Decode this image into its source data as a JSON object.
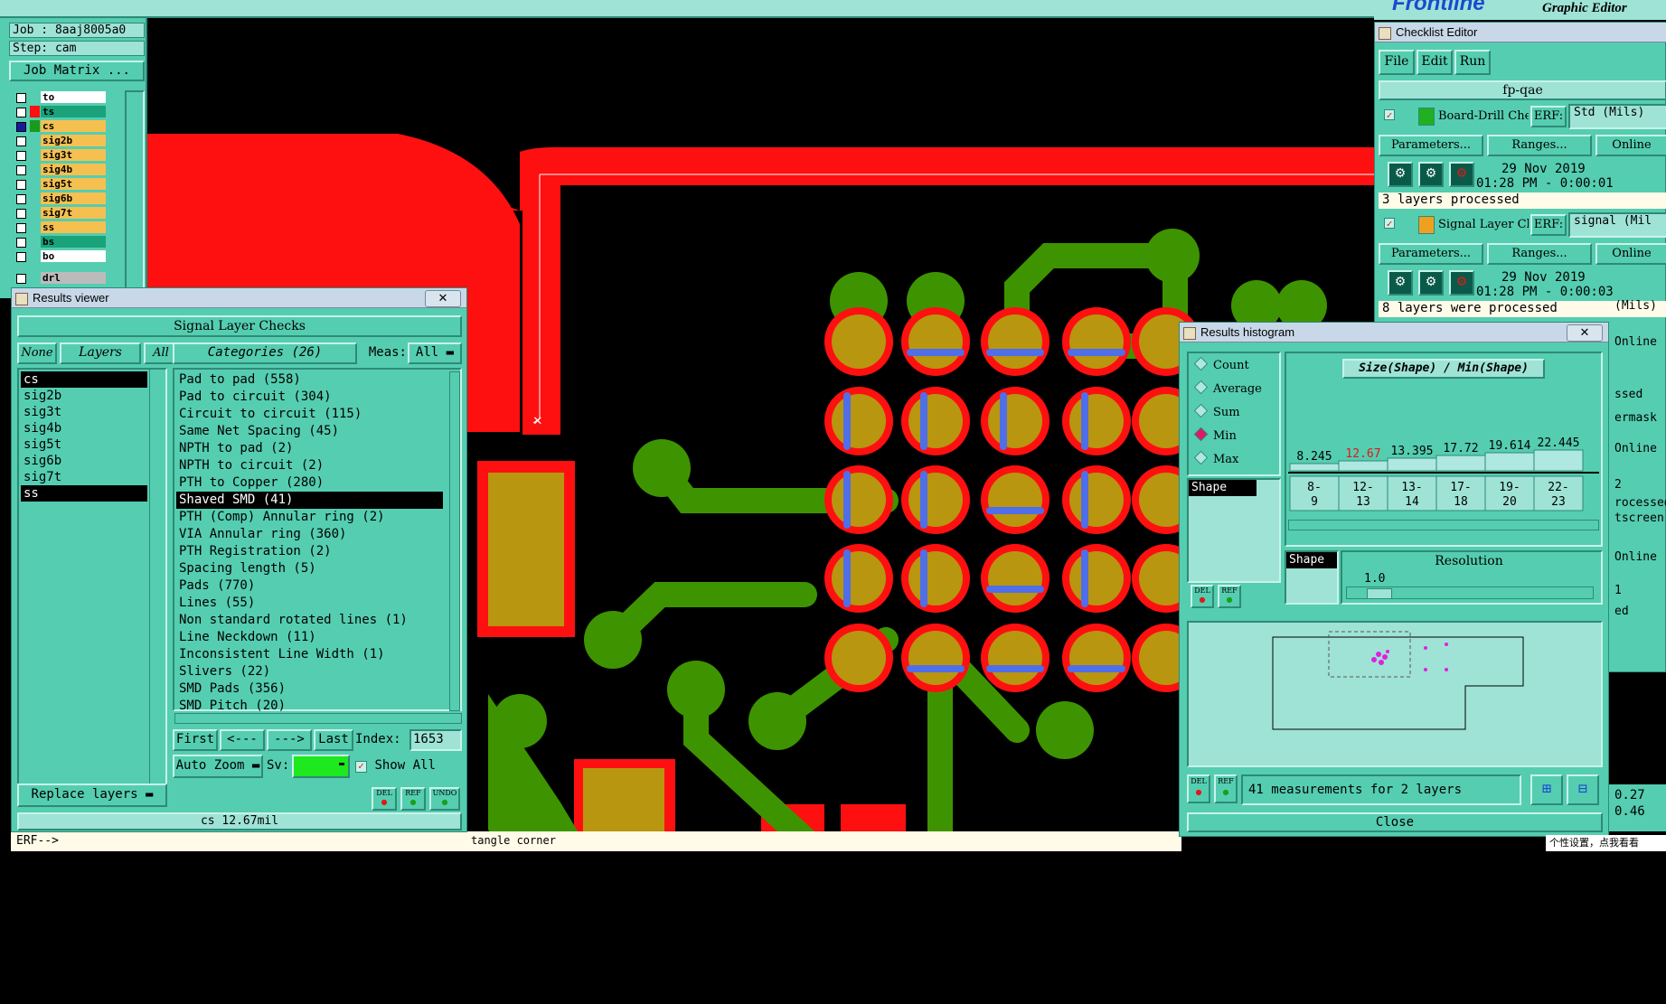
{
  "app": {
    "brand": "Frontline",
    "subtitle": "Graphic Editor"
  },
  "job_panel": {
    "job": "Job : 8aaj8005a0",
    "step": "Step: cam",
    "job_matrix_label": "Job Matrix ...",
    "layers": [
      {
        "name": "to",
        "color": "#ffffff"
      },
      {
        "name": "ts",
        "color": "#1aa37a"
      },
      {
        "name": "cs",
        "color": "#f5c050"
      },
      {
        "name": "sig2b",
        "color": "#f5c050"
      },
      {
        "name": "sig3t",
        "color": "#f5c050"
      },
      {
        "name": "sig4b",
        "color": "#f5c050"
      },
      {
        "name": "sig5t",
        "color": "#f5c050"
      },
      {
        "name": "sig6b",
        "color": "#f5c050"
      },
      {
        "name": "sig7t",
        "color": "#f5c050"
      },
      {
        "name": "ss",
        "color": "#f5c050"
      },
      {
        "name": "bs",
        "color": "#1aa37a"
      },
      {
        "name": "bo",
        "color": "#ffffff"
      },
      {
        "name": "drl",
        "color": "#bbbbbb"
      }
    ]
  },
  "results_viewer": {
    "title": "Results viewer",
    "heading": "Signal Layer Checks",
    "none_label": "None",
    "layers_label": "Layers",
    "all_label": "All",
    "categories_label": "Categories (26)",
    "meas_label": "Meas:",
    "meas_value": "All",
    "layers": [
      "cs",
      "sig2b",
      "sig3t",
      "sig4b",
      "sig5t",
      "sig6b",
      "sig7t",
      "ss"
    ],
    "categories": [
      "Pad to pad (558)",
      "Pad to circuit (304)",
      "Circuit to circuit (115)",
      "Same Net Spacing (45)",
      "NPTH to pad (2)",
      "NPTH to circuit (2)",
      "PTH to Copper (280)",
      "Shaved SMD (41)",
      "PTH (Comp) Annular ring (2)",
      "VIA Annular ring (360)",
      "PTH Registration (2)",
      "Spacing length (5)",
      "Pads (770)",
      "Lines (55)",
      "Non standard rotated lines (1)",
      "Line Neckdown (11)",
      "Inconsistent Line Width (1)",
      "Slivers (22)",
      "SMD Pads (356)",
      "SMD Pitch (20)"
    ],
    "first": "First",
    "prev": "<---",
    "next": "--->",
    "last": "Last",
    "index_label": "Index:",
    "index_value": "1653",
    "auto_zoom": "Auto Zoom",
    "sv_label": "Sv:",
    "show_all": "Show All",
    "replace_layers": "Replace layers",
    "del": "DEL",
    "ref": "REF",
    "undo": "UNDO",
    "status": "cs 12.67mil"
  },
  "command_line": {
    "prompt": "ERF-->",
    "hint": "tangle corner"
  },
  "checklist_editor": {
    "title": "Checklist Editor",
    "menu": [
      "File",
      "Edit",
      "Run"
    ],
    "checklist_name": "fp-qae",
    "items": [
      {
        "name": "Board-Drill Che",
        "erf_label": "ERF:",
        "erf_value": "Std (Mils)",
        "params": "Parameters...",
        "ranges": "Ranges...",
        "online": "Online",
        "date": "29 Nov 2019",
        "time": "01:28 PM - 0:00:01",
        "status": "3 layers processed"
      },
      {
        "name": "Signal Layer Ch",
        "erf_label": "ERF:",
        "erf_value": "signal (Mil",
        "params": "Parameters...",
        "ranges": "Ranges...",
        "online": "Online",
        "date": "29 Nov 2019",
        "time": "01:28 PM - 0:00:03",
        "status": "8 layers were processed"
      }
    ],
    "partial_right": [
      "(Mils)",
      "Online",
      "ssed",
      "ermask",
      "Online",
      "2",
      "rocessed",
      "tscreen",
      "Online",
      "1",
      "ed"
    ]
  },
  "histogram": {
    "title": "Results histogram",
    "modes": [
      "Count",
      "Average",
      "Sum",
      "Min",
      "Max"
    ],
    "selected_mode": "Min",
    "chart_title": "Size(Shape) / Min(Shape)",
    "list_item": "Shape",
    "bins": [
      {
        "range": "8-9",
        "lo": "8-",
        "hi": "9",
        "value": "8.245",
        "color": "#000000"
      },
      {
        "range": "12-13",
        "lo": "12-",
        "hi": "13",
        "value": "12.67",
        "color": "#e01818"
      },
      {
        "range": "13-14",
        "lo": "13-",
        "hi": "14",
        "value": "13.395",
        "color": "#000000"
      },
      {
        "range": "17-18",
        "lo": "17-",
        "hi": "18",
        "value": "17.72",
        "color": "#000000"
      },
      {
        "range": "19-20",
        "lo": "19-",
        "hi": "20",
        "value": "19.614",
        "color": "#000000"
      },
      {
        "range": "22-23",
        "lo": "22-",
        "hi": "23",
        "value": "22.445",
        "color": "#000000"
      }
    ],
    "shape_label": "Shape",
    "resolution_label": "Resolution",
    "resolution_value": "1.0",
    "del": "DEL",
    "ref": "REF",
    "summary": "41 measurements for 2 layers",
    "close": "Close"
  },
  "right_edge": {
    "v1": "0.27",
    "v2": "0.46",
    "ime": "个性设置，点我看看"
  }
}
